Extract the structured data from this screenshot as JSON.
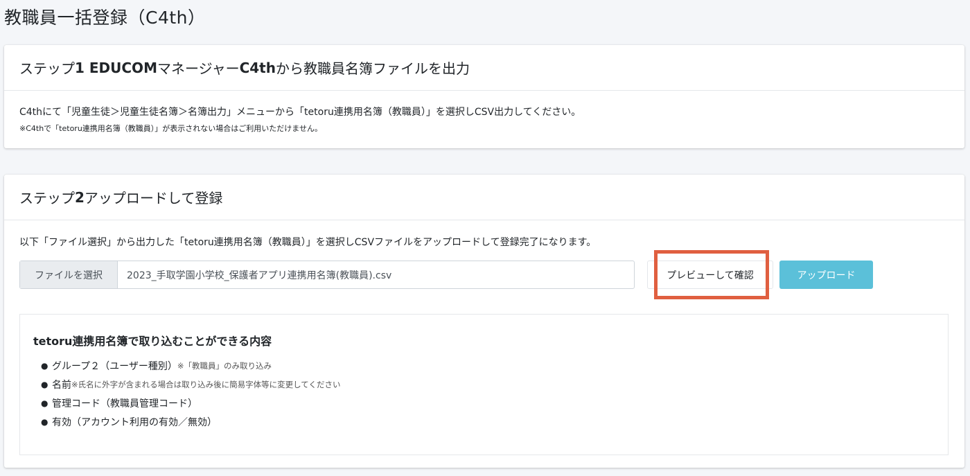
{
  "page": {
    "title": "教職員一括登録（C4th）"
  },
  "step1": {
    "header_prefix": "ステップ",
    "header_bold": "1 EDUCOM",
    "header_middle": "マネージャー",
    "header_bold2": "C4th",
    "header_suffix": "から教職員名簿ファイルを出力",
    "description": "C4thにて「児童生徒＞児童生徒名簿＞名簿出力」メニューから「tetoru連携用名簿（教職員）」を選択しCSV出力してください。",
    "note": "※C4thで「tetoru連携用名簿（教職員）」が表示されない場合はご利用いただけません。"
  },
  "step2": {
    "header_prefix": "ステップ",
    "header_bold": "2",
    "header_suffix": " アップロードして登録",
    "description": "以下「ファイル選択」から出力した「tetoru連携用名簿（教職員）」を選択しCSVファイルをアップロードして登録完了になります。",
    "file_button_label": "ファイルを選択",
    "file_name": "2023_手取学園小学校_保護者アプリ連携用名簿(教職員).csv",
    "preview_button_label": "プレビューして確認",
    "upload_button_label": "アップロード",
    "highlight_color": "#e05f40",
    "upload_button_color": "#5bc0d9"
  },
  "info": {
    "title": "tetoru連携用名簿で取り込むことができる内容",
    "items": [
      {
        "main": "グループ２（ユーザー種別）",
        "note": "※「教職員」のみ取り込み"
      },
      {
        "main": "名前",
        "note": "※氏名に外字が含まれる場合は取り込み後に簡易字体等に変更してください"
      },
      {
        "main": "管理コード（教職員管理コード）",
        "note": ""
      },
      {
        "main": "有効（アカウント利用の有効／無効）",
        "note": ""
      }
    ]
  }
}
